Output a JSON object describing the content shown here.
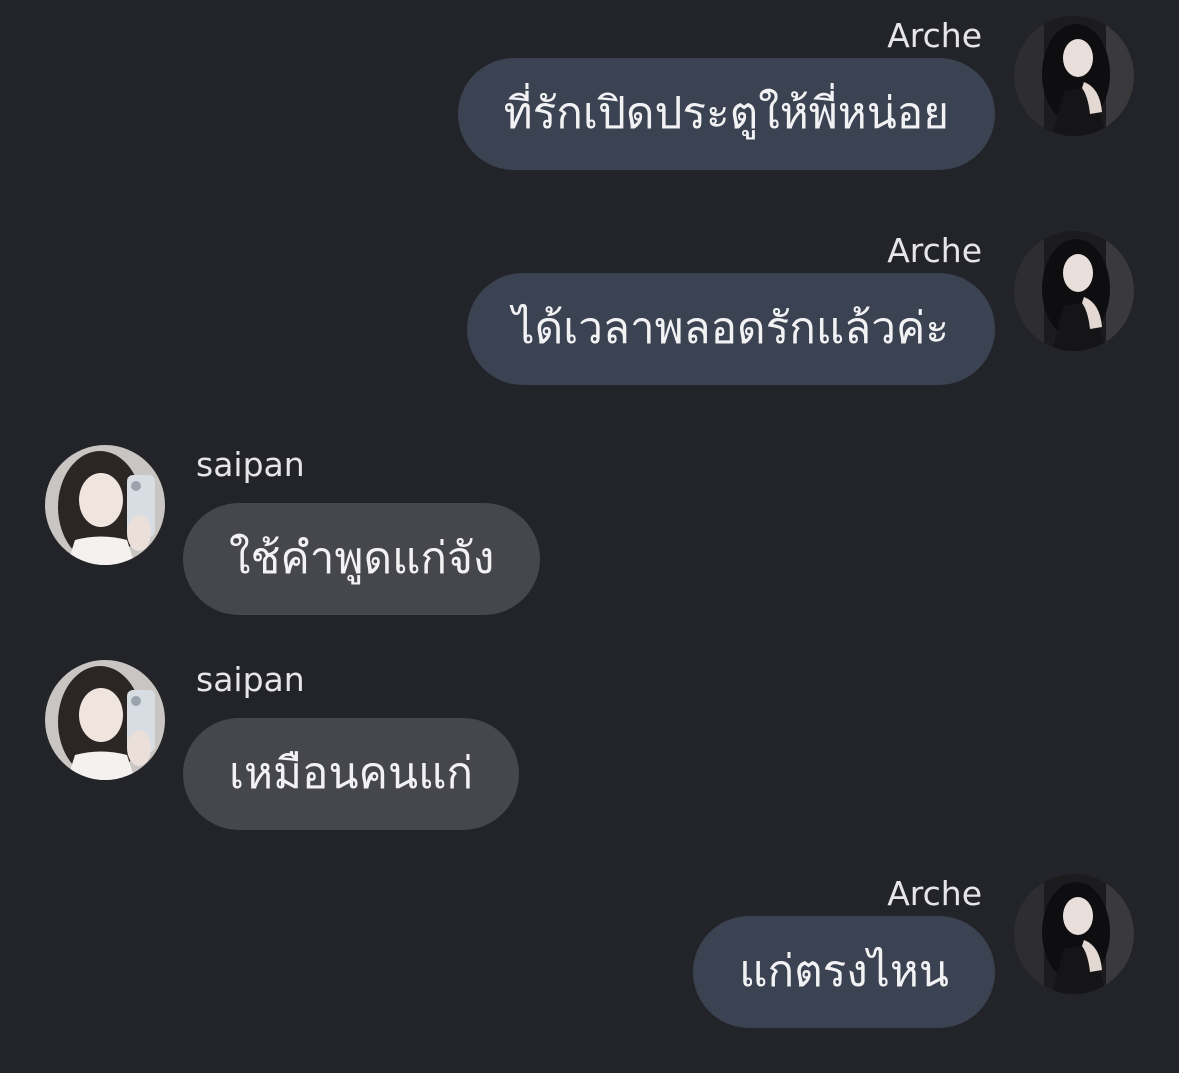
{
  "messages": [
    {
      "side": "right",
      "sender": "Arche",
      "text": "ที่รักเปิดประตูให้พี่หน่อย",
      "avatar": "arche-avatar"
    },
    {
      "side": "right",
      "sender": "Arche",
      "text": "ได้เวลาพลอดรักแล้วค่ะ",
      "avatar": "arche-avatar"
    },
    {
      "side": "left",
      "sender": "saipan",
      "text": "ใช้คำพูดแก่จัง",
      "avatar": "saipan-avatar"
    },
    {
      "side": "left",
      "sender": "saipan",
      "text": "เหมือนคนแก่",
      "avatar": "saipan-avatar"
    },
    {
      "side": "right",
      "sender": "Arche",
      "text": "แก่ตรงไหน",
      "avatar": "arche-avatar"
    }
  ],
  "colors": {
    "background": "#232429",
    "outgoing_bubble": "#3b4252",
    "incoming_bubble": "#46474d",
    "text": "#f2f2f4",
    "name": "#e6e6e9"
  }
}
